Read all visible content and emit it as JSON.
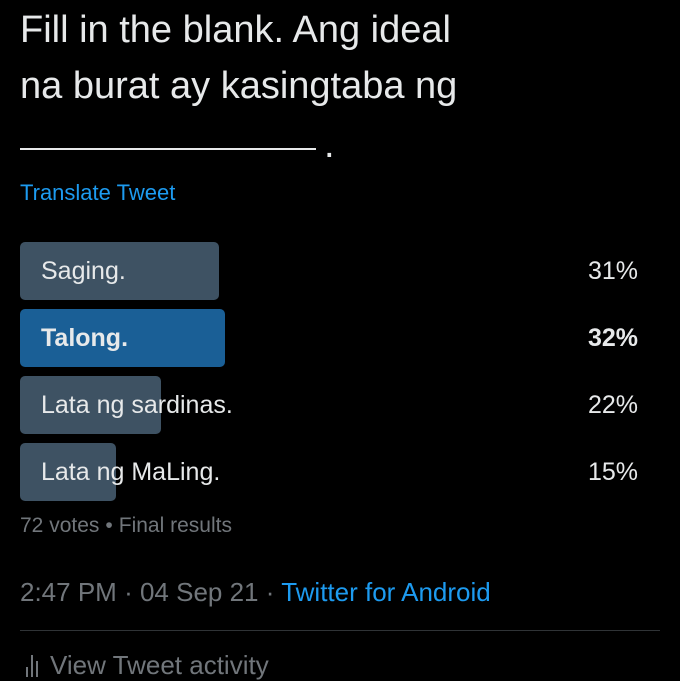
{
  "tweet": {
    "text_line1": "Fill in the blank. Ang ideal",
    "text_line2": "na burat ay kasingtaba ng",
    "blank_end": ".",
    "translate_label": "Translate Tweet"
  },
  "poll": {
    "options": [
      {
        "label": "Saging.",
        "percent": 31,
        "percent_label": "31%",
        "winner": false
      },
      {
        "label": "Talong.",
        "percent": 32,
        "percent_label": "32%",
        "winner": true
      },
      {
        "label": "Lata ng sardinas.",
        "percent": 22,
        "percent_label": "22%",
        "winner": false
      },
      {
        "label": "Lata ng MaLing.",
        "percent": 15,
        "percent_label": "15%",
        "winner": false
      }
    ],
    "votes": "72 votes",
    "separator": "•",
    "status": "Final results"
  },
  "meta": {
    "time": "2:47 PM",
    "dot": "·",
    "date": "04 Sep 21",
    "source": "Twitter for Android"
  },
  "activity": {
    "label": "View Tweet activity",
    "icon": "bar-chart-icon"
  },
  "colors": {
    "background": "#000000",
    "text": "#e7e9ea",
    "muted": "#71767b",
    "link": "#1d9bf0",
    "bar": "#3e5263",
    "bar_winner": "#1a5f96"
  }
}
